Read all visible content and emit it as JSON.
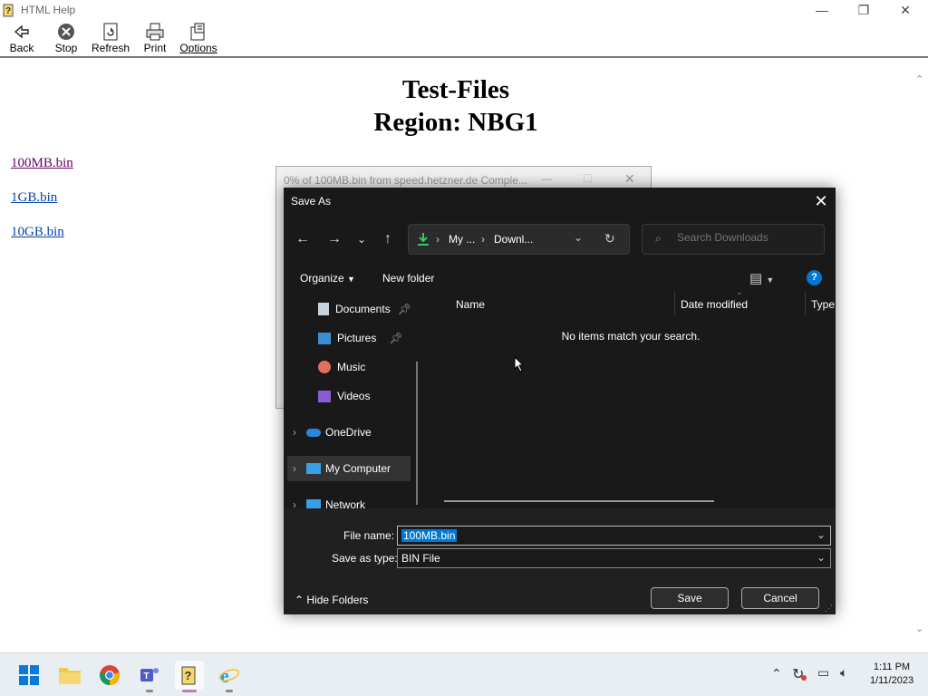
{
  "window": {
    "title": "HTML Help",
    "minimize_glyph": "—",
    "maximize_glyph": "❐",
    "close_glyph": "✕"
  },
  "toolbar": {
    "back": "Back",
    "stop": "Stop",
    "refresh": "Refresh",
    "print": "Print",
    "options": "Options"
  },
  "content": {
    "title_line1": "Test-Files",
    "title_line2": "Region: NBG1",
    "links": [
      "100MB.bin",
      "1GB.bin",
      "10GB.bin"
    ],
    "visited_color": "#660066",
    "link_color": "#0645ad"
  },
  "progress_window": {
    "title": "0% of 100MB.bin from speed.hetzner.de Comple..."
  },
  "save_dialog": {
    "title": "Save As",
    "address": {
      "segment1": "My ...",
      "segment2": "Downl..."
    },
    "search_placeholder": "Search Downloads",
    "organize": "Organize",
    "new_folder": "New folder",
    "nav_items": [
      {
        "label": "Documents",
        "icon": "documents-icon",
        "pinned": true
      },
      {
        "label": "Pictures",
        "icon": "pictures-icon",
        "pinned": true
      },
      {
        "label": "Music",
        "icon": "music-icon",
        "pinned": false
      },
      {
        "label": "Videos",
        "icon": "videos-icon",
        "pinned": false
      },
      {
        "label": "OneDrive",
        "icon": "onedrive-icon",
        "pinned": false
      },
      {
        "label": "My Computer",
        "icon": "computer-icon",
        "pinned": false
      },
      {
        "label": "Network",
        "icon": "network-icon",
        "pinned": false
      }
    ],
    "columns": [
      "Name",
      "Date modified",
      "Type"
    ],
    "empty_message": "No items match your search.",
    "file_name_label": "File name:",
    "file_name_value": "100MB.bin",
    "save_as_type_label": "Save as type:",
    "save_as_type_value": "BIN File",
    "hide_folders": "Hide Folders",
    "save_button": "Save",
    "cancel_button": "Cancel",
    "accent_color": "#0078d4"
  },
  "taskbar": {
    "time": "1:11 PM",
    "date": "1/11/2023"
  }
}
